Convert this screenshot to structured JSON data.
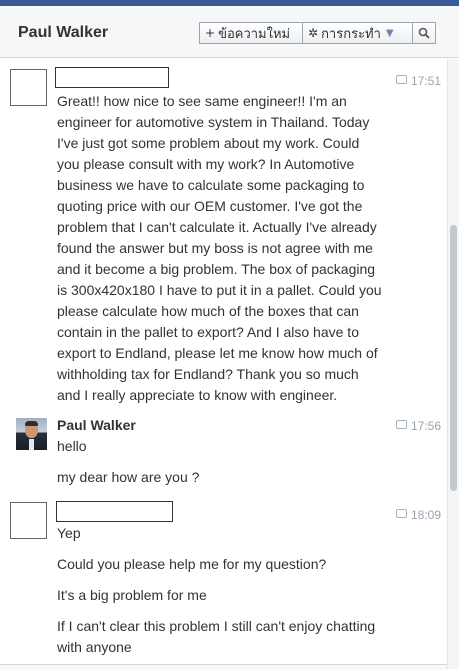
{
  "header": {
    "title": "Paul Walker",
    "new_message_label": "ข้อความใหม่",
    "actions_label": "การกระทำ",
    "icons": {
      "new": "plus-icon",
      "actions": "gear-icon",
      "search": "search-icon"
    }
  },
  "messages": [
    {
      "time": "17:51",
      "lines": [
        "Great!! how nice to see same engineer!! I'm an",
        "engineer for automotive system in Thailand. Today",
        "I've just got some problem about my work. Could",
        "you please consult with my work? In Automotive",
        "business we have to calculate some packaging to",
        "quoting price with our OEM customer. I've got the",
        "problem that I can't calculate it. Actually I've already",
        "found the answer but my boss is not agree with me",
        "and it become a big problem. The box of packaging",
        "is 300x420x180 I have to put it in a pallet. Could you",
        "please calculate how much of the boxes that can",
        "contain in the pallet to export? And I also have to",
        "export to Endland, please let me know how much of",
        "withholding tax for Endland? Thank you so much",
        "and I really appreciate to know with engineer."
      ]
    },
    {
      "sender": "Paul Walker",
      "time": "17:56",
      "paras": [
        "hello",
        "my dear how are you ?"
      ]
    },
    {
      "time": "18:09",
      "paras": [
        [
          "Yep"
        ],
        [
          "Could you please help me for my question?"
        ],
        [
          "It's a big problem for me"
        ],
        [
          "If I can't clear this problem I still can't enjoy chatting",
          "with anyone"
        ]
      ]
    }
  ]
}
